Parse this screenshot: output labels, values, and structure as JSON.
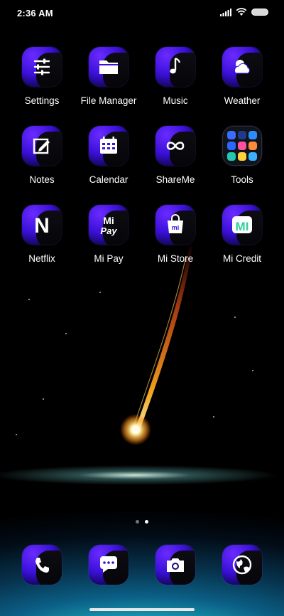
{
  "status": {
    "time": "2:36 AM"
  },
  "apps": [
    {
      "label": "Settings",
      "icon": "settings-sliders-icon"
    },
    {
      "label": "File Manager",
      "icon": "folder-icon"
    },
    {
      "label": "Music",
      "icon": "music-note-icon"
    },
    {
      "label": "Weather",
      "icon": "weather-icon"
    },
    {
      "label": "Notes",
      "icon": "notes-edit-icon"
    },
    {
      "label": "Calendar",
      "icon": "calendar-icon"
    },
    {
      "label": "ShareMe",
      "icon": "infinity-icon"
    },
    {
      "label": "Tools",
      "icon": "tools-folder-icon"
    },
    {
      "label": "Netflix",
      "icon": "netflix-icon"
    },
    {
      "label": "Mi Pay",
      "icon": "mi-pay-icon"
    },
    {
      "label": "Mi Store",
      "icon": "mi-store-bag-icon"
    },
    {
      "label": "Mi Credit",
      "icon": "mi-credit-icon"
    }
  ],
  "icon_text": {
    "netflix": "N",
    "mipay_top": "Mi",
    "mipay_bottom": "Pay",
    "mistore": "mi",
    "micredit": "MI"
  },
  "page_indicator": {
    "count": 2,
    "active": 2
  },
  "dock": [
    {
      "icon": "phone-icon"
    },
    {
      "icon": "messages-icon"
    },
    {
      "icon": "camera-icon"
    },
    {
      "icon": "browser-globe-icon"
    }
  ],
  "colors": {
    "icon_accent": "#4a1cf0",
    "netflix_white": "#ffffff",
    "micredit_green": "#2ad39a"
  }
}
